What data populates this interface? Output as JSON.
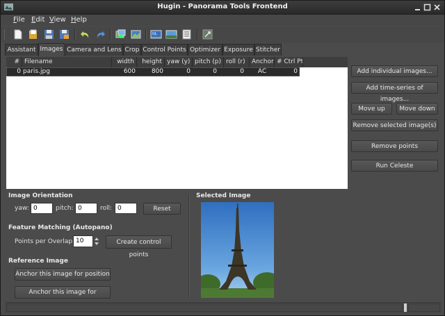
{
  "window": {
    "title": "Hugin - Panorama Tools Frontend"
  },
  "menu": [
    {
      "label": "File",
      "key": "F",
      "rest": "ile"
    },
    {
      "label": "Edit",
      "key": "E",
      "rest": "dit"
    },
    {
      "label": "View",
      "key": "V",
      "rest": "iew"
    },
    {
      "label": "Help",
      "key": "H",
      "rest": "elp"
    }
  ],
  "toolbar": [
    "new-project-icon",
    "open-project-icon",
    "save-icon",
    "save-as-icon",
    "undo-icon",
    "redo-icon",
    "add-images-icon",
    "add-time-series-icon",
    "preview-icon",
    "fast-preview-icon",
    "show-list-icon",
    "optimize-icon"
  ],
  "tabs": [
    "Assistant",
    "Images",
    "Camera and Lens",
    "Crop",
    "Control Points",
    "Optimizer",
    "Exposure",
    "Stitcher"
  ],
  "active_tab": "Images",
  "table": {
    "headers": [
      "#",
      "Filename",
      "width",
      "height",
      "yaw (y)",
      "pitch (p)",
      "roll (r)",
      "Anchor",
      "# Ctrl Pt"
    ],
    "rows": [
      [
        "0",
        "paris.jpg",
        "600",
        "800",
        "0",
        "0",
        "0",
        "AC",
        "0"
      ]
    ]
  },
  "side_buttons": {
    "add_individual": "Add individual images...",
    "add_time_series": "Add time-series of images...",
    "move_up": "Move up",
    "move_down": "Move down",
    "remove_selected": "Remove selected image(s)",
    "remove_points": "Remove points",
    "run_celeste": "Run Celeste"
  },
  "orientation": {
    "title": "Image Orientation",
    "yaw_label": "yaw:",
    "yaw": "0",
    "pitch_label": "pitch:",
    "pitch": "0",
    "roll_label": "roll:",
    "roll": "0",
    "reset": "Reset"
  },
  "feature": {
    "title": "Feature Matching (Autopano)",
    "points_label": "Points per Overlap:",
    "points": "10",
    "create": "Create control points"
  },
  "reference": {
    "title": "Reference Image",
    "anchor_position": "Anchor this image for position",
    "anchor_exposure": "Anchor this image for exposure"
  },
  "selected": {
    "title": "Selected Image"
  },
  "colors": {
    "window_bg": "#4b4b4b",
    "titlebar": "#2a2a2a",
    "table_bg": "#ffffff",
    "sky": "#4a86c8"
  }
}
